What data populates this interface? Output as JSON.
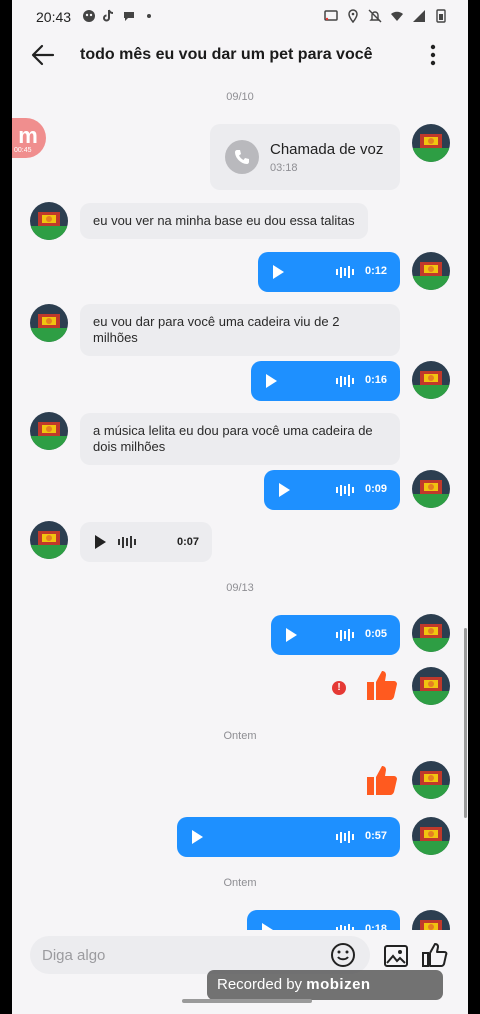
{
  "status_bar": {
    "time": "20:43"
  },
  "header": {
    "title": "todo mês eu vou dar um pet para você"
  },
  "floating_badge": {
    "letter": "m",
    "timer": "00:45"
  },
  "messages": {
    "date_1": "09/10",
    "call": {
      "title": "Chamada de voz",
      "duration": "03:18"
    },
    "in_1": "eu vou ver na minha base eu dou essa talitas",
    "out_audio_1": "0:12",
    "in_2": "eu vou dar para você uma cadeira viu de 2 milhões",
    "out_audio_2": "0:16",
    "in_3": "a música lelita eu dou para você uma cadeira de dois milhões",
    "out_audio_3": "0:09",
    "in_audio_1": "0:07",
    "date_2": "09/13",
    "out_audio_4": "0:05",
    "error_mark": "!",
    "date_3": "Ontem",
    "out_audio_5": "0:57",
    "date_4": "Ontem",
    "out_audio_6": "0:18"
  },
  "composer": {
    "placeholder": "Diga algo"
  },
  "recorder_banner": {
    "prefix": "Recorded by",
    "brand": "mobizen"
  },
  "colors": {
    "accent_blue": "#1e90ff",
    "like_orange": "#ff5a1f",
    "background": "#f6f5f7"
  }
}
